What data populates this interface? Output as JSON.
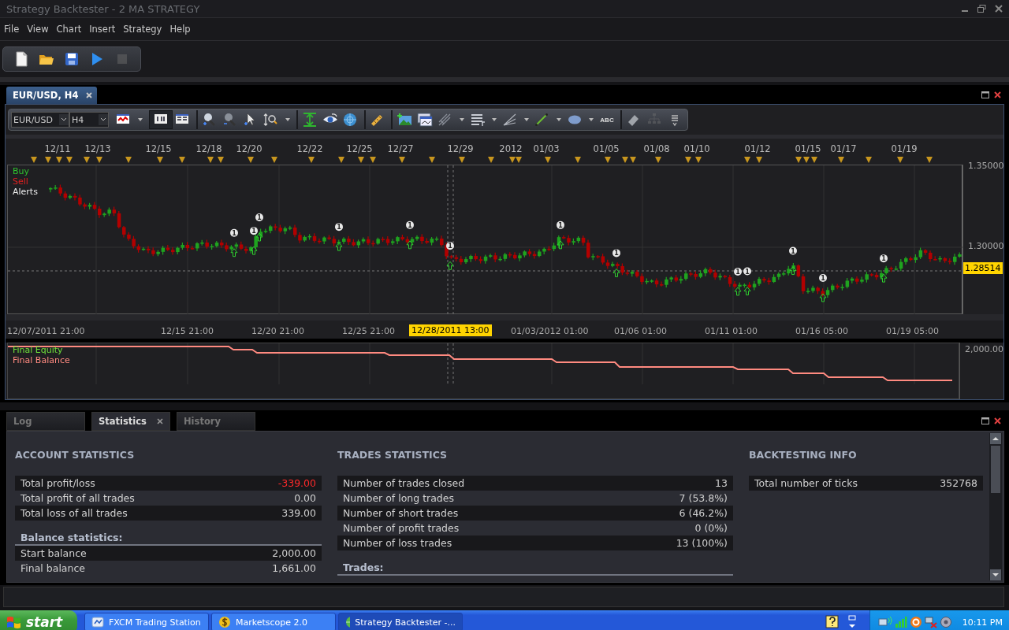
{
  "window": {
    "title": "Strategy Backtester - 2 MA STRATEGY"
  },
  "menu": [
    "File",
    "View",
    "Chart",
    "Insert",
    "Strategy",
    "Help"
  ],
  "main_toolbar": [
    {
      "kind": "new",
      "disabled": false
    },
    {
      "kind": "open",
      "disabled": false
    },
    {
      "kind": "save",
      "disabled": false
    },
    {
      "kind": "run",
      "disabled": false
    },
    {
      "kind": "stop",
      "disabled": true
    }
  ],
  "chart_window": {
    "tab": "EUR/USD, H4",
    "symbol": "EUR/USD",
    "timeframe": "H4",
    "tools": [
      {
        "kind": "chart-type",
        "dropdown": true,
        "selected": false,
        "disabled": false,
        "separator_before": false
      },
      {
        "kind": "bars",
        "dropdown": false,
        "selected": true,
        "disabled": false,
        "separator_before": true
      },
      {
        "kind": "table",
        "dropdown": false,
        "selected": false,
        "disabled": false,
        "separator_before": false
      },
      {
        "kind": "zoom-in",
        "dropdown": false,
        "selected": false,
        "disabled": false,
        "separator_before": true
      },
      {
        "kind": "zoom-out",
        "dropdown": false,
        "selected": false,
        "disabled": false,
        "separator_before": false
      },
      {
        "kind": "cursor",
        "dropdown": false,
        "selected": false,
        "disabled": false,
        "separator_before": false
      },
      {
        "kind": "zoom-area",
        "dropdown": true,
        "selected": false,
        "disabled": false,
        "separator_before": false
      },
      {
        "kind": "vscale",
        "dropdown": false,
        "selected": false,
        "disabled": false,
        "separator_before": true
      },
      {
        "kind": "eye",
        "dropdown": false,
        "selected": false,
        "disabled": false,
        "separator_before": false
      },
      {
        "kind": "globe",
        "dropdown": false,
        "selected": false,
        "disabled": false,
        "separator_before": false
      },
      {
        "kind": "ruler",
        "dropdown": false,
        "selected": false,
        "disabled": false,
        "separator_before": true
      },
      {
        "kind": "add-image",
        "dropdown": false,
        "selected": false,
        "disabled": false,
        "separator_before": true
      },
      {
        "kind": "window",
        "dropdown": false,
        "selected": false,
        "disabled": false,
        "separator_before": false
      },
      {
        "kind": "fork",
        "dropdown": true,
        "selected": false,
        "disabled": false,
        "separator_before": false
      },
      {
        "kind": "list",
        "dropdown": true,
        "selected": false,
        "disabled": false,
        "separator_before": false
      },
      {
        "kind": "fan",
        "dropdown": true,
        "selected": false,
        "disabled": false,
        "separator_before": false
      },
      {
        "kind": "line",
        "dropdown": true,
        "selected": false,
        "disabled": false,
        "separator_before": false
      },
      {
        "kind": "ellipse",
        "dropdown": true,
        "selected": false,
        "disabled": false,
        "separator_before": false
      },
      {
        "kind": "text",
        "label": "ABC",
        "dropdown": false,
        "selected": false,
        "disabled": false,
        "separator_before": false
      },
      {
        "kind": "eraser",
        "dropdown": false,
        "selected": false,
        "disabled": false,
        "separator_before": true
      },
      {
        "kind": "tree",
        "dropdown": false,
        "selected": false,
        "disabled": true,
        "separator_before": false
      },
      {
        "kind": "more",
        "dropdown": false,
        "selected": false,
        "disabled": false,
        "separator_before": false
      }
    ],
    "date_strip": [
      "12/11",
      "12/13",
      "12/15",
      "12/18",
      "12/20",
      "12/22",
      "12/25",
      "12/27",
      "12/29",
      "2012",
      "01/03",
      "01/05",
      "01/08",
      "01/10",
      "01/12",
      "01/15",
      "01/17",
      "01/19"
    ],
    "legend": [
      "Buy",
      "Sell",
      "Alerts"
    ],
    "trade_markers": [
      {
        "label": "1"
      },
      {
        "label": "1"
      },
      {
        "label": "1"
      },
      {
        "label": "1"
      },
      {
        "label": "1"
      },
      {
        "label": "1"
      },
      {
        "label": "1"
      },
      {
        "label": "1"
      },
      {
        "label": "1"
      },
      {
        "label": "1"
      },
      {
        "label": "1"
      },
      {
        "label": "1"
      },
      {
        "label": "1"
      }
    ],
    "price_ticks": [
      "1.35000",
      "1.30000"
    ],
    "current_price": "1.28514",
    "time_axis": [
      "12/07/2011 21:00",
      "12/15 21:00",
      "12/20 21:00",
      "12/25 21:00",
      "01/03/2012 01:00",
      "01/06 01:00",
      "01/11 01:00",
      "01/16 05:00",
      "01/19 05:00"
    ],
    "crosshair_time": "12/28/2011 13:00",
    "equity_legend": [
      "Final Equity",
      "Final Balance"
    ],
    "equity_tick": "2,000.00"
  },
  "bottom_panel": {
    "tabs": [
      {
        "label": "Log",
        "selected": false,
        "closable": false
      },
      {
        "label": "Statistics",
        "selected": true,
        "closable": true
      },
      {
        "label": "History",
        "selected": false,
        "closable": false
      }
    ],
    "sections": [
      {
        "title": "ACCOUNT STATISTICS",
        "blocks": [
          {
            "kind": "rows",
            "rows": [
              {
                "label": "Total profit/loss",
                "value": "-339.00",
                "negative": true
              },
              {
                "label": "Total profit of all trades",
                "value": "0.00",
                "negative": false
              },
              {
                "label": "Total loss of all trades",
                "value": "339.00",
                "negative": false
              }
            ]
          },
          {
            "kind": "subheading",
            "text": "Balance statistics:"
          },
          {
            "kind": "rows",
            "rows": [
              {
                "label": "Start balance",
                "value": "2,000.00",
                "negative": false
              },
              {
                "label": "Final balance",
                "value": "1,661.00",
                "negative": false
              }
            ]
          }
        ]
      },
      {
        "title": "TRADES STATISTICS",
        "blocks": [
          {
            "kind": "rows",
            "rows": [
              {
                "label": "Number of trades closed",
                "value": "13",
                "negative": false
              },
              {
                "label": "Number of long trades",
                "value": "7 (53.8%)",
                "negative": false
              },
              {
                "label": "Number of short trades",
                "value": "6 (46.2%)",
                "negative": false
              },
              {
                "label": "Number of profit trades",
                "value": "0 (0%)",
                "negative": false
              },
              {
                "label": "Number of loss trades",
                "value": "13 (100%)",
                "negative": false
              }
            ]
          },
          {
            "kind": "subheading",
            "text": "Trades:"
          }
        ]
      },
      {
        "title": "BACKTESTING INFO",
        "blocks": [
          {
            "kind": "rows",
            "rows": [
              {
                "label": "Total number of ticks",
                "value": "352768",
                "negative": false
              }
            ]
          }
        ]
      }
    ]
  },
  "taskbar": {
    "start": "start",
    "tasks": [
      {
        "label": "FXCM Trading Station",
        "kind": "app",
        "selected": false
      },
      {
        "label": "Marketscope 2.0",
        "kind": "dollar",
        "selected": false
      },
      {
        "label": "Strategy Backtester -...",
        "kind": "globe",
        "selected": true
      }
    ],
    "clock": "10:11 PM"
  }
}
